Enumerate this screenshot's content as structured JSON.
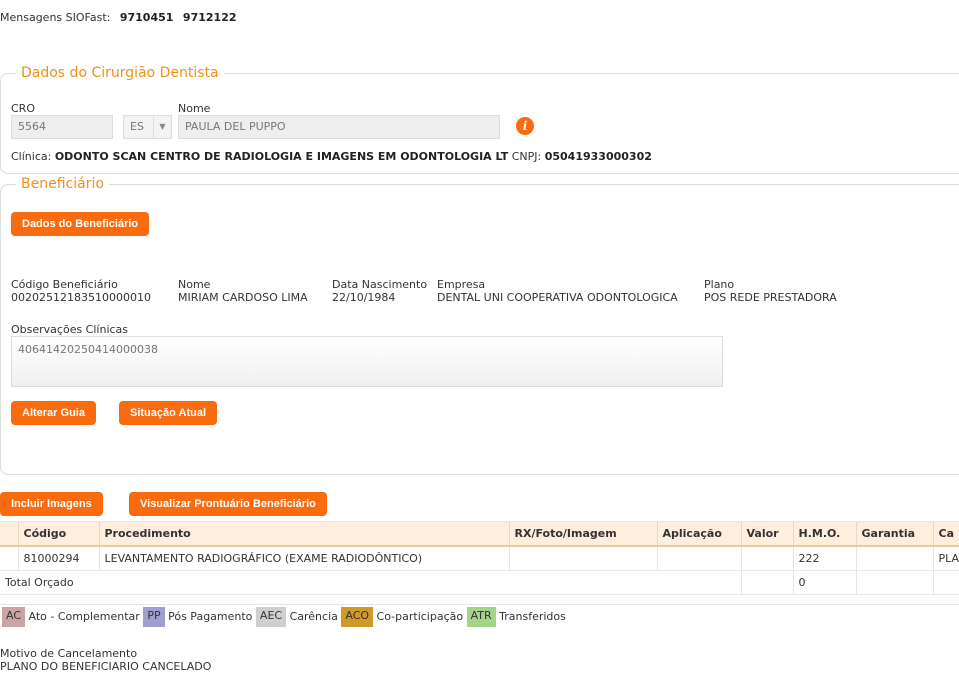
{
  "header": {
    "label": "Mensagens SIOFast:",
    "codes": [
      "9710451",
      "9712122"
    ]
  },
  "dentista": {
    "legend": "Dados do Cirurgião Dentista",
    "cro_label": "CRO",
    "cro_value": "5564",
    "uf_value": "ES",
    "nome_label": "Nome",
    "nome_value": "PAULA DEL PUPPO",
    "clinica_label": "Clínica:",
    "clinica_value": "ODONTO SCAN CENTRO DE RADIOLOGIA E IMAGENS EM ODONTOLOGIA LT",
    "cnpj_label": "CNPJ:",
    "cnpj_value": "05041933000302"
  },
  "beneficiario": {
    "legend": "Beneficiário",
    "dados_button": "Dados do Beneficiário",
    "fields": [
      {
        "label": "Código Beneficiário",
        "value": "00202512183510000010"
      },
      {
        "label": "Nome",
        "value": "MIRIAM CARDOSO LIMA"
      },
      {
        "label": "Data Nascimento",
        "value": "22/10/1984"
      },
      {
        "label": "Empresa",
        "value": "DENTAL UNI COOPERATIVA ODONTOLOGICA"
      },
      {
        "label": "Plano",
        "value": "POS REDE PRESTADORA"
      }
    ],
    "obs_label": "Observações Clínicas",
    "obs_value": "40641420250414000038",
    "alterar_button": "Alterar Guia",
    "situacao_button": "Situação Atual"
  },
  "actions": {
    "incluir": "Incluir Imagens",
    "visualizar": "Visualizar Prontuário Beneficiário"
  },
  "table": {
    "headers": [
      "Código",
      "Procedimento",
      "RX/Foto/Imagem",
      "Aplicação",
      "Valor",
      "H.M.O.",
      "Garantia",
      "Ca"
    ],
    "rows": [
      [
        "81000294",
        "LEVANTAMENTO RADIOGRÁFICO (EXAME RADIODÔNTICO)",
        "",
        "",
        "",
        "222",
        "",
        "PLA"
      ]
    ],
    "total_label": "Total Orçado",
    "total_value": "0"
  },
  "legend_items": [
    {
      "code": "AC",
      "label": "Ato - Complementar",
      "color": "#c9a5a5"
    },
    {
      "code": "PP",
      "label": "Pós Pagamento",
      "color": "#a09fd0"
    },
    {
      "code": "AEC",
      "label": "Carência",
      "color": "#cfcfcf"
    },
    {
      "code": "ACO",
      "label": "Co-participação",
      "color": "#d09a2a"
    },
    {
      "code": "ATR",
      "label": "Transferidos",
      "color": "#a6d38a"
    }
  ],
  "cancelamento": {
    "label": "Motivo de Cancelamento",
    "value": "PLANO DO BENEFICIARIO CANCELADO"
  }
}
